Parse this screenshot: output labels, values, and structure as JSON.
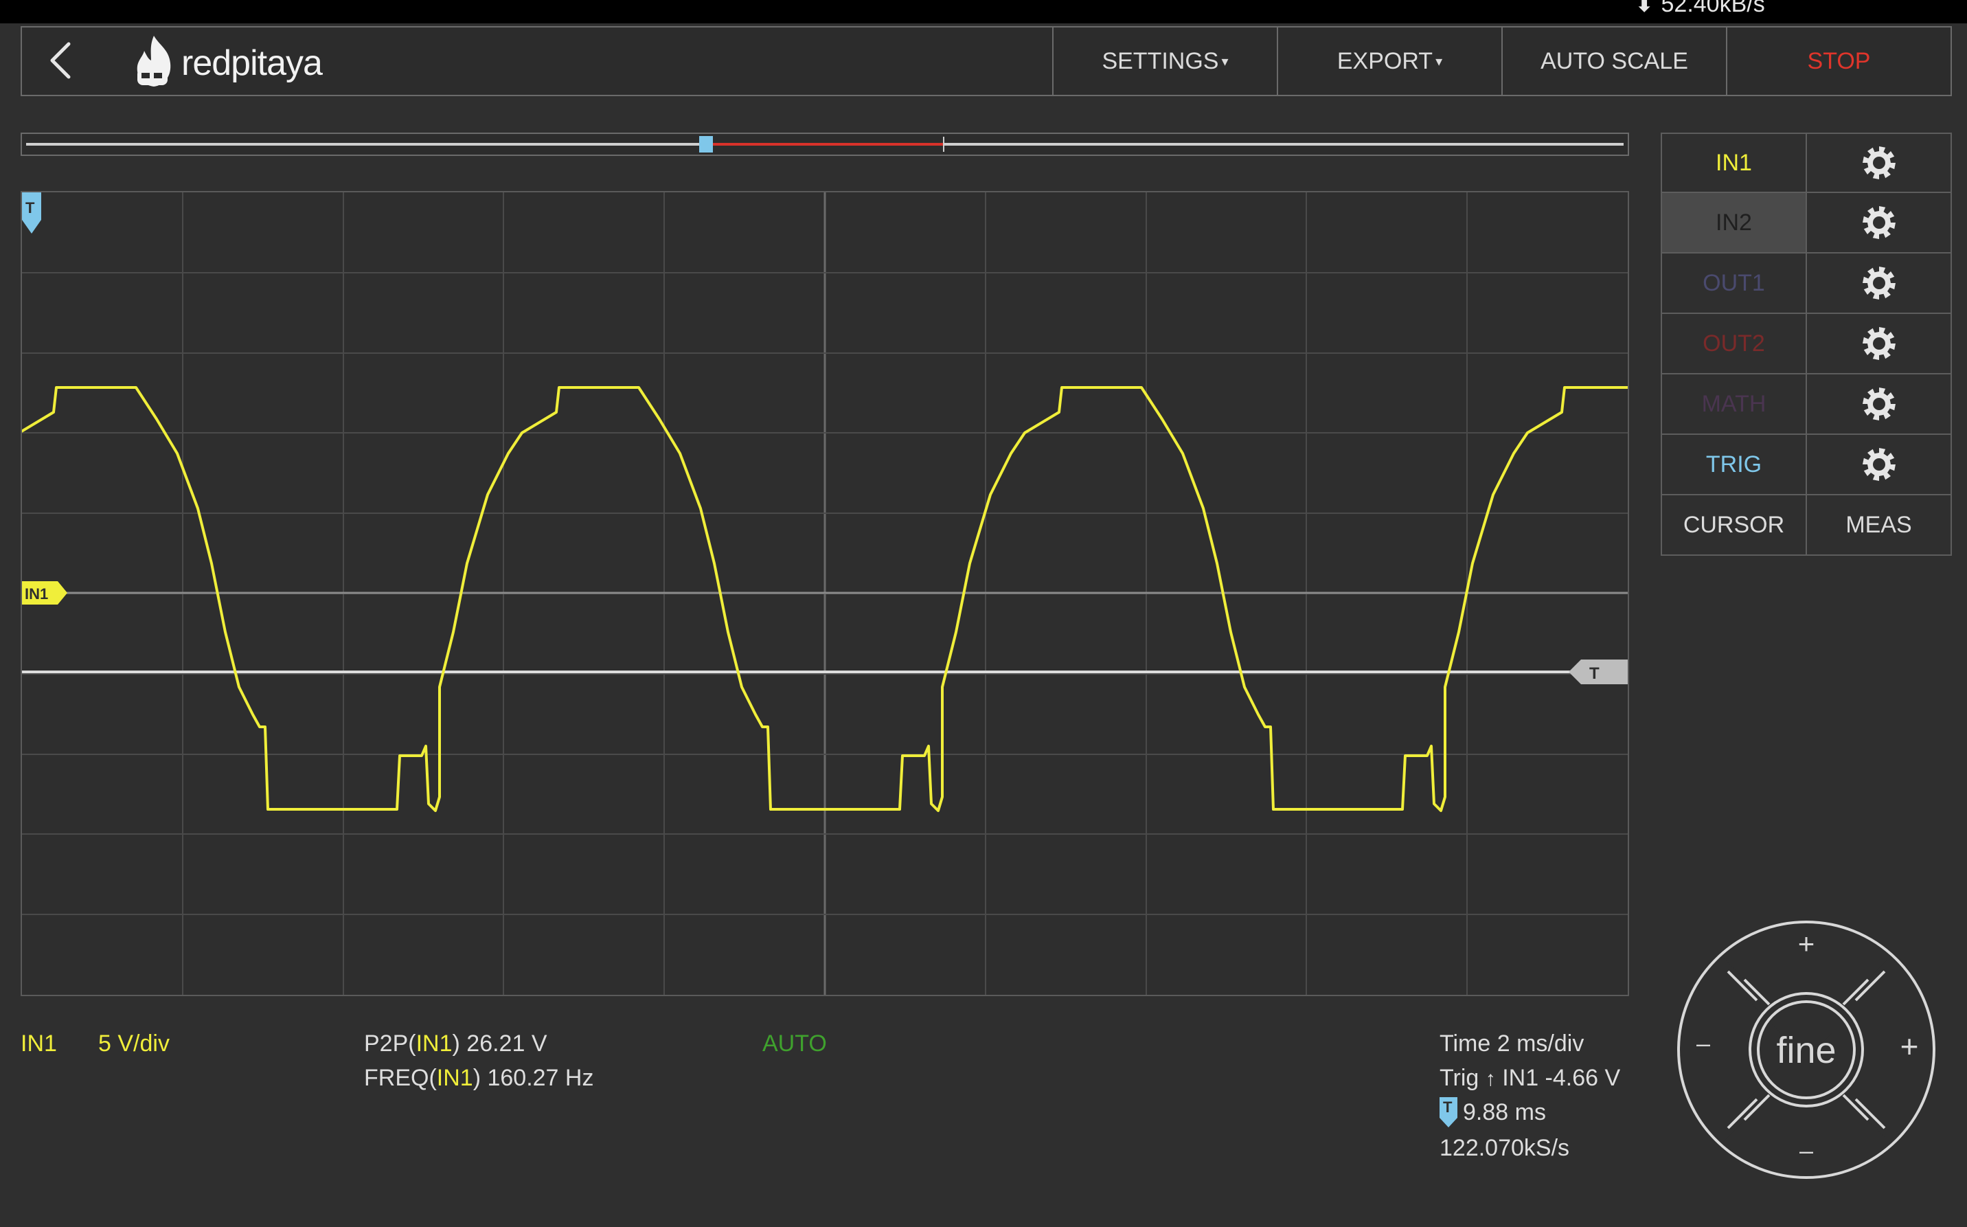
{
  "status_bar": {
    "speed": "52.40kB/s"
  },
  "header": {
    "logo_text": "redpitaya",
    "menu": [
      {
        "label": "SETTINGS",
        "dropdown": true
      },
      {
        "label": "EXPORT",
        "dropdown": true
      },
      {
        "label": "AUTO SCALE",
        "dropdown": false
      },
      {
        "label": "STOP",
        "dropdown": false
      }
    ]
  },
  "channel_panel": {
    "rows": [
      {
        "label": "IN1",
        "color": "#f0ee3a",
        "selected": false
      },
      {
        "label": "IN2",
        "color": "#1f1f1f",
        "selected": true
      },
      {
        "label": "OUT1",
        "color": "#4a4a6e",
        "selected": false
      },
      {
        "label": "OUT2",
        "color": "#7a2a2a",
        "selected": false
      },
      {
        "label": "MATH",
        "color": "#4a3550",
        "selected": false
      },
      {
        "label": "TRIG",
        "color": "#7fc7ea",
        "selected": false
      }
    ],
    "cursor_label": "CURSOR",
    "meas_label": "MEAS"
  },
  "plot": {
    "in1_marker": "IN1",
    "trigger_marker": "T",
    "time_marker": "T",
    "trace_color": "#f0ee3a"
  },
  "bottom_info": {
    "channel": "IN1",
    "scale": "5 V/div",
    "p2p_prefix": "P2P(",
    "p2p_channel": "IN1",
    "p2p_suffix": ") 26.21 V",
    "freq_prefix": "FREQ(",
    "freq_channel": "IN1",
    "freq_suffix": ") 160.27 Hz",
    "trigger_mode": "AUTO",
    "time": "Time 2 ms/div",
    "trig": "Trig",
    "trig_value": "IN1 -4.66 V",
    "time_offset_marker": "T",
    "time_offset": "9.88 ms",
    "sample_rate": "122.070kS/s"
  },
  "dpad": {
    "center": "fine",
    "up": "+",
    "down": "–",
    "left": "–",
    "right": "+"
  }
}
